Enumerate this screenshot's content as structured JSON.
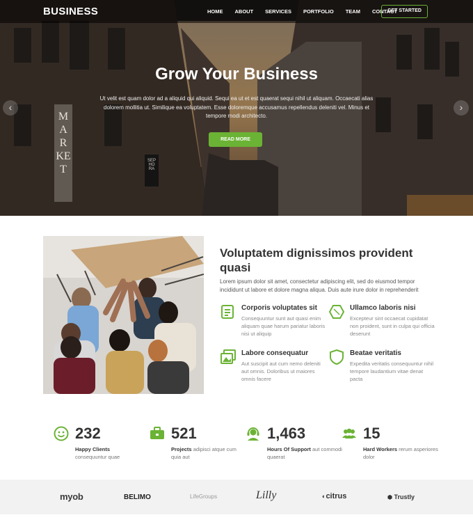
{
  "header": {
    "logo": "BUSINESS",
    "nav": [
      "HOME",
      "ABOUT",
      "SERVICES",
      "PORTFOLIO",
      "TEAM",
      "CONTACT"
    ],
    "cta": "GET STARTED"
  },
  "hero": {
    "title": "Grow Your Business",
    "text": "Ut velit est quam dolor ad a aliquid qui aliquid. Sequi ea ut et est quaerat sequi nihil ut aliquam. Occaecati alias dolorem mollitia ut. Similique ea voluptatem. Esse doloremque accusamus repellendus deleniti vel. Minus et tempore modi architecto.",
    "button": "READ MORE",
    "prev": "‹",
    "next": "›",
    "sign_market": "MARKET",
    "sign_sephora": "SEPHORA"
  },
  "about": {
    "title": "Voluptatem dignissimos provident quasi",
    "description": "Lorem ipsum dolor sit amet, consectetur adipiscing elit, sed do eiusmod tempor incididunt ut labore et dolore magna aliqua. Duis aute irure dolor in reprehenderit",
    "features": [
      {
        "title": "Corporis voluptates sit",
        "text": "Consequuntur sunt aut quasi enim aliquam quae harum pariatur laboris nisi ut aliquip",
        "icon": "receipt-icon"
      },
      {
        "title": "Ullamco laboris nisi",
        "text": "Excepteur sint occaecat cupidatat non proident, sunt in culpa qui officia deserunt",
        "icon": "cube-icon"
      },
      {
        "title": "Labore consequatur",
        "text": "Aut suscipit aut cum nemo deleniti aut omnis. Doloribus ut maiores omnis facere",
        "icon": "images-icon"
      },
      {
        "title": "Beatae veritatis",
        "text": "Expedita veritatis consequuntur nihil tempore laudantium vitae denat pacta",
        "icon": "shield-icon"
      }
    ]
  },
  "stats": [
    {
      "number": "232",
      "label": "Happy Clients",
      "text": "consequuntur quae",
      "icon": "smile-icon"
    },
    {
      "number": "521",
      "label": "Projects",
      "text": "adipisci atque cum quia aut",
      "icon": "briefcase-icon"
    },
    {
      "number": "1,463",
      "label": "Hours Of Support",
      "text": "aut commodi quaerat",
      "icon": "headset-icon"
    },
    {
      "number": "15",
      "label": "Hard Workers",
      "text": "rerum asperiores dolor",
      "icon": "people-icon"
    }
  ],
  "clients": [
    "myob",
    "BELIMO",
    "LifeGroups",
    "Lilly",
    "citrus",
    "Trustly"
  ],
  "colors": {
    "accent": "#6bb335",
    "dark": "#333333",
    "band": "#f2f2f2"
  }
}
